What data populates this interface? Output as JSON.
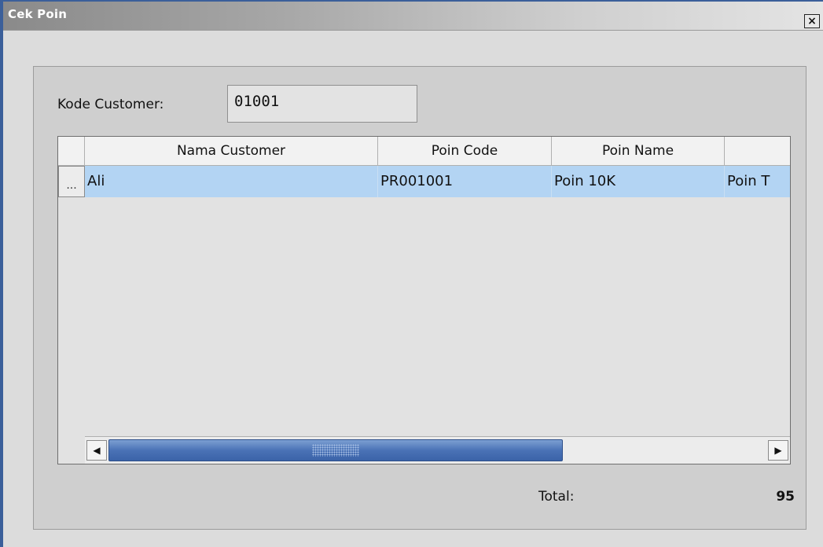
{
  "window": {
    "title": "Cek Poin",
    "close_symbol": "×"
  },
  "form": {
    "kode_customer_label": "Kode Customer:",
    "kode_customer_value": "01001"
  },
  "table": {
    "columns": [
      "Nama Customer",
      "Poin Code",
      "Poin Name",
      ""
    ],
    "rows": [
      {
        "selector": "...",
        "cells": [
          "Ali",
          "PR001001",
          "Poin 10K",
          "Poin T"
        ]
      }
    ],
    "selected_row_color": "#b3d4f3"
  },
  "scrollbar": {
    "left_arrow": "◀",
    "right_arrow": "▶"
  },
  "footer": {
    "total_label": "Total:",
    "total_value": "95"
  },
  "colors": {
    "window_border": "#3b5f9a",
    "scroll_thumb": "#4a72b6"
  },
  "icons": {
    "close": "close-icon",
    "scroll_left": "arrow-left-icon",
    "scroll_right": "arrow-right-icon"
  }
}
